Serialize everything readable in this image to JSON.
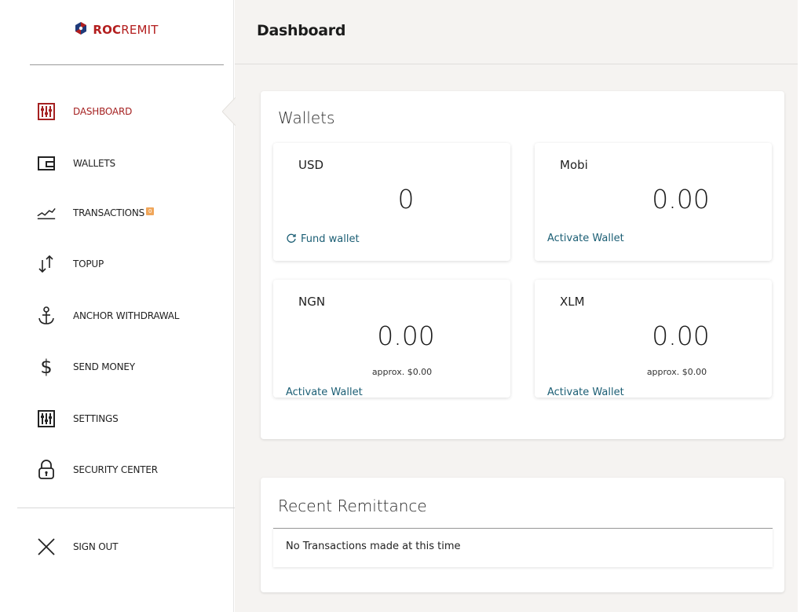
{
  "app": {
    "logo_text_bold": "ROC",
    "logo_text_rest": "REMIT",
    "brand_color": "#b31e1e",
    "link_color": "#1b5e74"
  },
  "sidebar": {
    "items": [
      {
        "label": "DASHBOARD",
        "icon": "sliders-icon",
        "active": true
      },
      {
        "label": "WALLETS",
        "icon": "wallet-icon"
      },
      {
        "label": "TRANSACTIONS",
        "icon": "trend-line-icon",
        "badge": "0"
      },
      {
        "label": "TOPUP",
        "icon": "transfer-arrows-icon"
      },
      {
        "label": "ANCHOR WITHDRAWAL",
        "icon": "anchor-icon"
      },
      {
        "label": "SEND MONEY",
        "icon": "dollar-icon"
      },
      {
        "label": "SETTINGS",
        "icon": "sliders-icon"
      },
      {
        "label": "SECURITY CENTER",
        "icon": "lock-icon"
      }
    ],
    "sign_out": {
      "label": "SIGN OUT",
      "icon": "close-icon"
    }
  },
  "header": {
    "title": "Dashboard"
  },
  "wallets_panel": {
    "title": "Wallets",
    "cards": [
      {
        "currency": "USD",
        "balance": "0",
        "approx": "",
        "action": "Fund wallet",
        "action_icon": "refresh-icon"
      },
      {
        "currency": "Mobi",
        "balance": "0.00",
        "approx": "",
        "action": "Activate Wallet"
      },
      {
        "currency": "NGN",
        "balance": "0.00",
        "approx": "approx. $0.00",
        "action": "Activate Wallet"
      },
      {
        "currency": "XLM",
        "balance": "0.00",
        "approx": "approx. $0.00",
        "action": "Activate Wallet"
      }
    ]
  },
  "recent_panel": {
    "title": "Recent Remittance",
    "empty_message": "No Transactions made at this time"
  }
}
